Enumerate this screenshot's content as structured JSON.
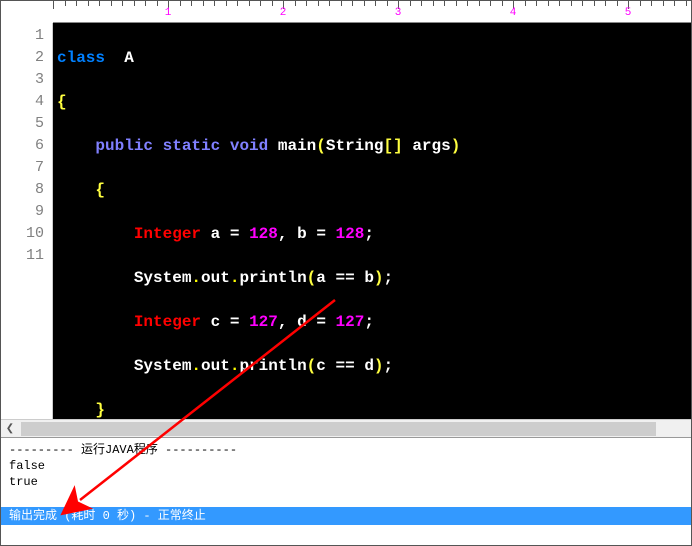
{
  "ruler": {
    "labels": [
      "1",
      "2",
      "3",
      "4",
      "5"
    ]
  },
  "gutter": {
    "lines": [
      "1",
      "2",
      "3",
      "4",
      "5",
      "6",
      "7",
      "8",
      "9",
      "10",
      "11"
    ]
  },
  "code": {
    "l1": {
      "kw": "class",
      "cls": "A"
    },
    "l2": {
      "brace": "{"
    },
    "l3": {
      "mod1": "public",
      "mod2": "static",
      "void": "void",
      "fn": "main",
      "lp": "(",
      "argtype": "String",
      "lb": "[",
      "rb": "]",
      "arg": "args",
      "rp": ")"
    },
    "l4": {
      "brace": "{"
    },
    "l5": {
      "type": "Integer",
      "v1": "a",
      "eq1": "=",
      "n1": "128",
      "c1": ",",
      "v2": "b",
      "eq2": "=",
      "n2": "128",
      "sc": ";"
    },
    "l6": {
      "obj": "System",
      "d1": ".",
      "out": "out",
      "d2": ".",
      "m": "println",
      "lp": "(",
      "a": "a",
      "op": "==",
      "b": "b",
      "rp": ")",
      "sc": ";"
    },
    "l7": {
      "type": "Integer",
      "v1": "c",
      "eq1": "=",
      "n1": "127",
      "c1": ",",
      "v2": "d",
      "eq2": "=",
      "n2": "127",
      "sc": ";"
    },
    "l8": {
      "obj": "System",
      "d1": ".",
      "out": "out",
      "d2": ".",
      "m": "println",
      "lp": "(",
      "a": "c",
      "op": "==",
      "b": "d",
      "rp": ")",
      "sc": ";"
    },
    "l9": {
      "brace": "}"
    },
    "l10": {
      "brace": "}"
    }
  },
  "output": {
    "header": "--------- 运行JAVA程序 ----------",
    "line1": "false",
    "line2": "true"
  },
  "status": {
    "text": "输出完成 (耗时 0 秒) - 正常终止"
  }
}
